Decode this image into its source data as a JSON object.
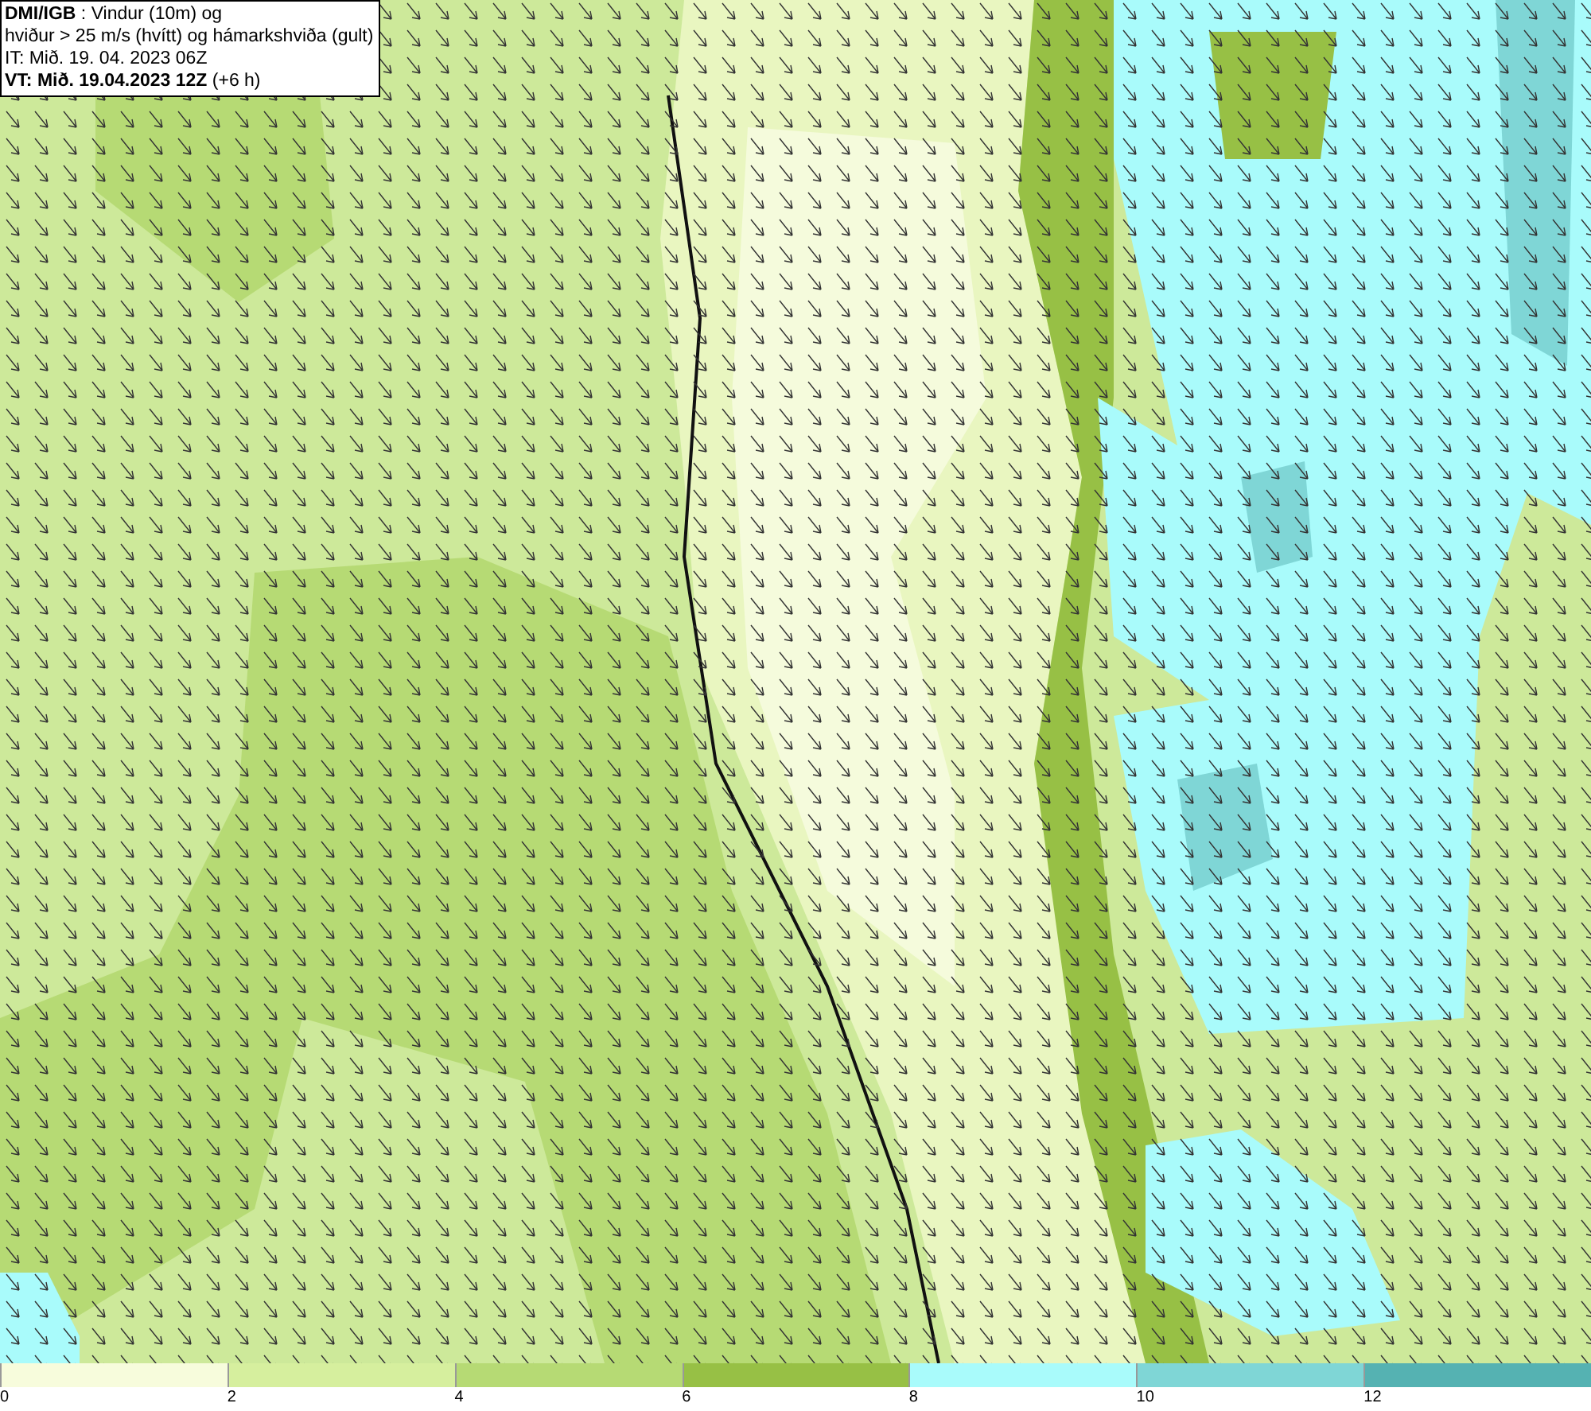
{
  "title_box": {
    "lines": [
      "**DMI/IGB** : Vindur (10m) og",
      "hviður > 25 m/s (hvítt) og hámarkshviða (gult)",
      "IT: Mið. 19. 04. 2023 06Z",
      "**VT: Mið. 19.04.2023 12Z** (+6 h)"
    ]
  },
  "legend": [
    {
      "label": "0",
      "color": "#f7fcdc"
    },
    {
      "label": "2",
      "color": "#d6ef9e"
    },
    {
      "label": "4",
      "color": "#b6da74"
    },
    {
      "label": "6",
      "color": "#97c045"
    },
    {
      "label": "8",
      "color": "#a9fbfb"
    },
    {
      "label": "10",
      "color": "#7fd6d6"
    },
    {
      "label": "12",
      "color": "#55b2b2"
    }
  ]
}
